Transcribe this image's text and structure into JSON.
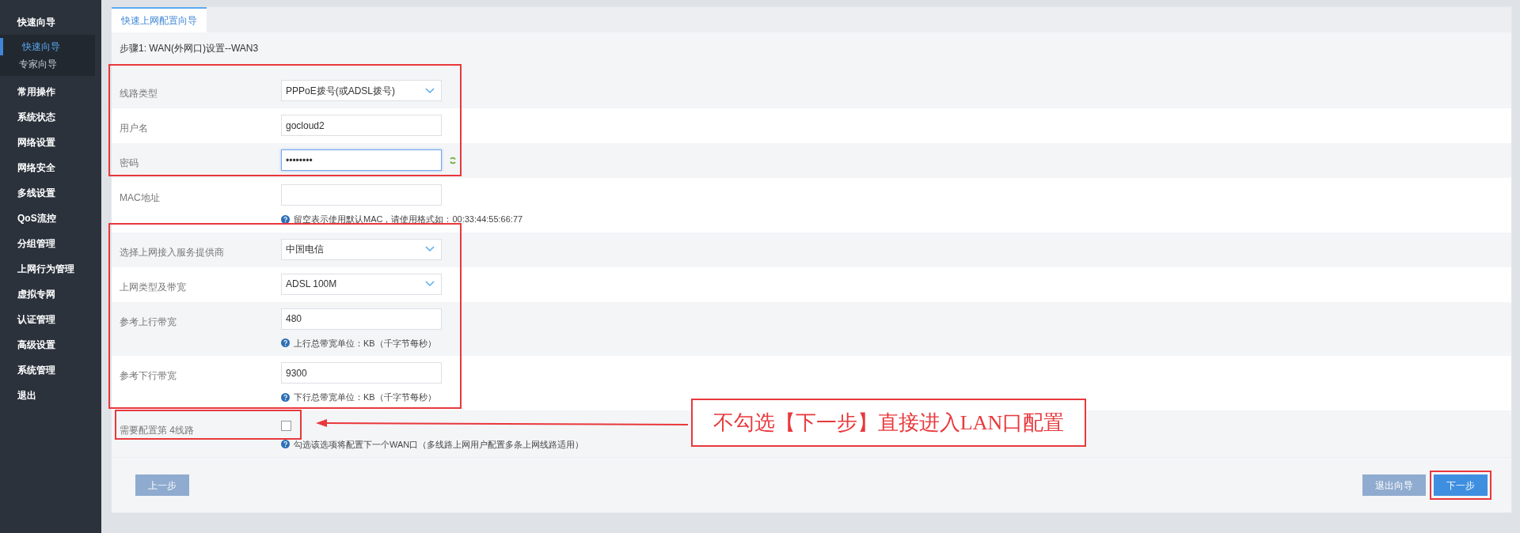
{
  "sidebar": {
    "items": [
      {
        "label": "快速向导",
        "children": [
          {
            "label": "快速向导",
            "selected": true
          },
          {
            "label": "专家向导",
            "selected": false
          }
        ]
      },
      {
        "label": "常用操作"
      },
      {
        "label": "系统状态"
      },
      {
        "label": "网络设置"
      },
      {
        "label": "网络安全"
      },
      {
        "label": "多线设置"
      },
      {
        "label": "QoS流控"
      },
      {
        "label": "分组管理"
      },
      {
        "label": "上网行为管理"
      },
      {
        "label": "虚拟专网"
      },
      {
        "label": "认证管理"
      },
      {
        "label": "高级设置"
      },
      {
        "label": "系统管理"
      },
      {
        "label": "退出"
      }
    ]
  },
  "tabs": [
    {
      "label": "快速上网配置向导",
      "selected": true
    }
  ],
  "step_title": "步骤1: WAN(外网口)设置--WAN3",
  "groups": [
    {
      "highlighted": true,
      "rows": [
        {
          "kind": "select",
          "label": "线路类型",
          "value": "PPPoE拨号(或ADSL拨号)"
        },
        {
          "kind": "text",
          "label": "用户名",
          "value": "gocloud2"
        },
        {
          "kind": "password",
          "label": "密码",
          "value": "••••••••",
          "focused": true
        }
      ]
    },
    {
      "rows": [
        {
          "kind": "text",
          "label": "MAC地址",
          "value": "",
          "hint": "留空表示使用默认MAC，请使用格式如：00:33:44:55:66:77"
        }
      ]
    },
    {
      "highlighted": true,
      "rows": [
        {
          "kind": "select",
          "label": "选择上网接入服务提供商",
          "value": "中国电信"
        },
        {
          "kind": "select",
          "label": "上网类型及带宽",
          "value": "ADSL 100M"
        },
        {
          "kind": "text",
          "label": "参考上行带宽",
          "value": "480",
          "hint": "上行总带宽单位：KB（千字节每秒）"
        },
        {
          "kind": "text",
          "label": "参考下行带宽",
          "value": "9300",
          "hint": "下行总带宽单位：KB（千字节每秒）"
        }
      ]
    },
    {
      "highlighted": true,
      "callout": "不勾选【下一步】直接进入LAN口配置",
      "rows": [
        {
          "kind": "checkbox",
          "label": "需要配置第 4线路",
          "checked": false,
          "hint": "勾选该选项将配置下一个WAN口（多线路上网用户配置多条上网线路适用）"
        }
      ]
    }
  ],
  "buttons": [
    {
      "label": "上一步",
      "disabled": true,
      "highlighted": false
    },
    {
      "label": "退出向导",
      "disabled": true,
      "highlighted": false
    },
    {
      "label": "下一步",
      "disabled": false,
      "highlighted": true
    }
  ]
}
